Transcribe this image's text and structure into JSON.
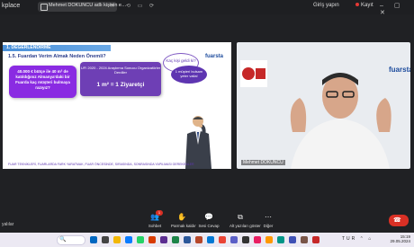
{
  "app": {
    "title": "kplace"
  },
  "share_tab": {
    "label": "Mehmet DOKUNCU adlı kişinin e…"
  },
  "header": {
    "signin": "Giriş yapın",
    "recording": "Kayıt"
  },
  "slide": {
    "section": "1. DEĞERLENDİRME",
    "subtitle": "1.5. Fuardan Verim Almak Neden Önemli?",
    "logo": "fuarsta",
    "purple_box": "40.000 € bütçe ile 40 m² de katıldığınız Almanya'daki bir Fuarda kaç müşteri bulmaya razıyız?",
    "center_box_line1": "UFI 2020 - 2024 Araştırma Sonucu Organizatörler Derdiler",
    "center_box_big": "1 m² = 1 Ziyaretçi",
    "bubble1": "Kaç kişi geldi ki?",
    "bubble2": "1 müşteri bulsam yeter valla!",
    "footer": "FUAR TEKNİKLERİ, FUARLARDA FARK YARATMAK, FUAR ÖNCESİNDE, SIRASINDA, SONRASINDA YAPILMASI GEREKENLER"
  },
  "video": {
    "name": "Mehmet DOKUNCU",
    "daib_logo": "DAİB",
    "fuar_logo": "fuarsta"
  },
  "side_name": "yalılar",
  "controls": [
    {
      "icon": "people-icon",
      "label": "Sohbet",
      "glyph": "👥",
      "badge": "1"
    },
    {
      "icon": "raise-hand-icon",
      "label": "Parmak kaldır",
      "glyph": "✋"
    },
    {
      "icon": "mic-icon",
      "label": "Sesi Cevap",
      "glyph": "💬"
    },
    {
      "icon": "screen-share-icon",
      "label": "Alt yazıları göster",
      "glyph": "⧉"
    },
    {
      "icon": "more-icon",
      "label": "Diğer",
      "glyph": "⋯"
    }
  ],
  "taskbar": {
    "search_glyph": "🔍",
    "tray": "TUR ⌃ ⌂",
    "time": "15:19",
    "date": "29.05.2024"
  },
  "colors": {
    "accent_purple": "#8a2be2",
    "leave_red": "#d93025",
    "slide_blue": "#4a90d9"
  }
}
